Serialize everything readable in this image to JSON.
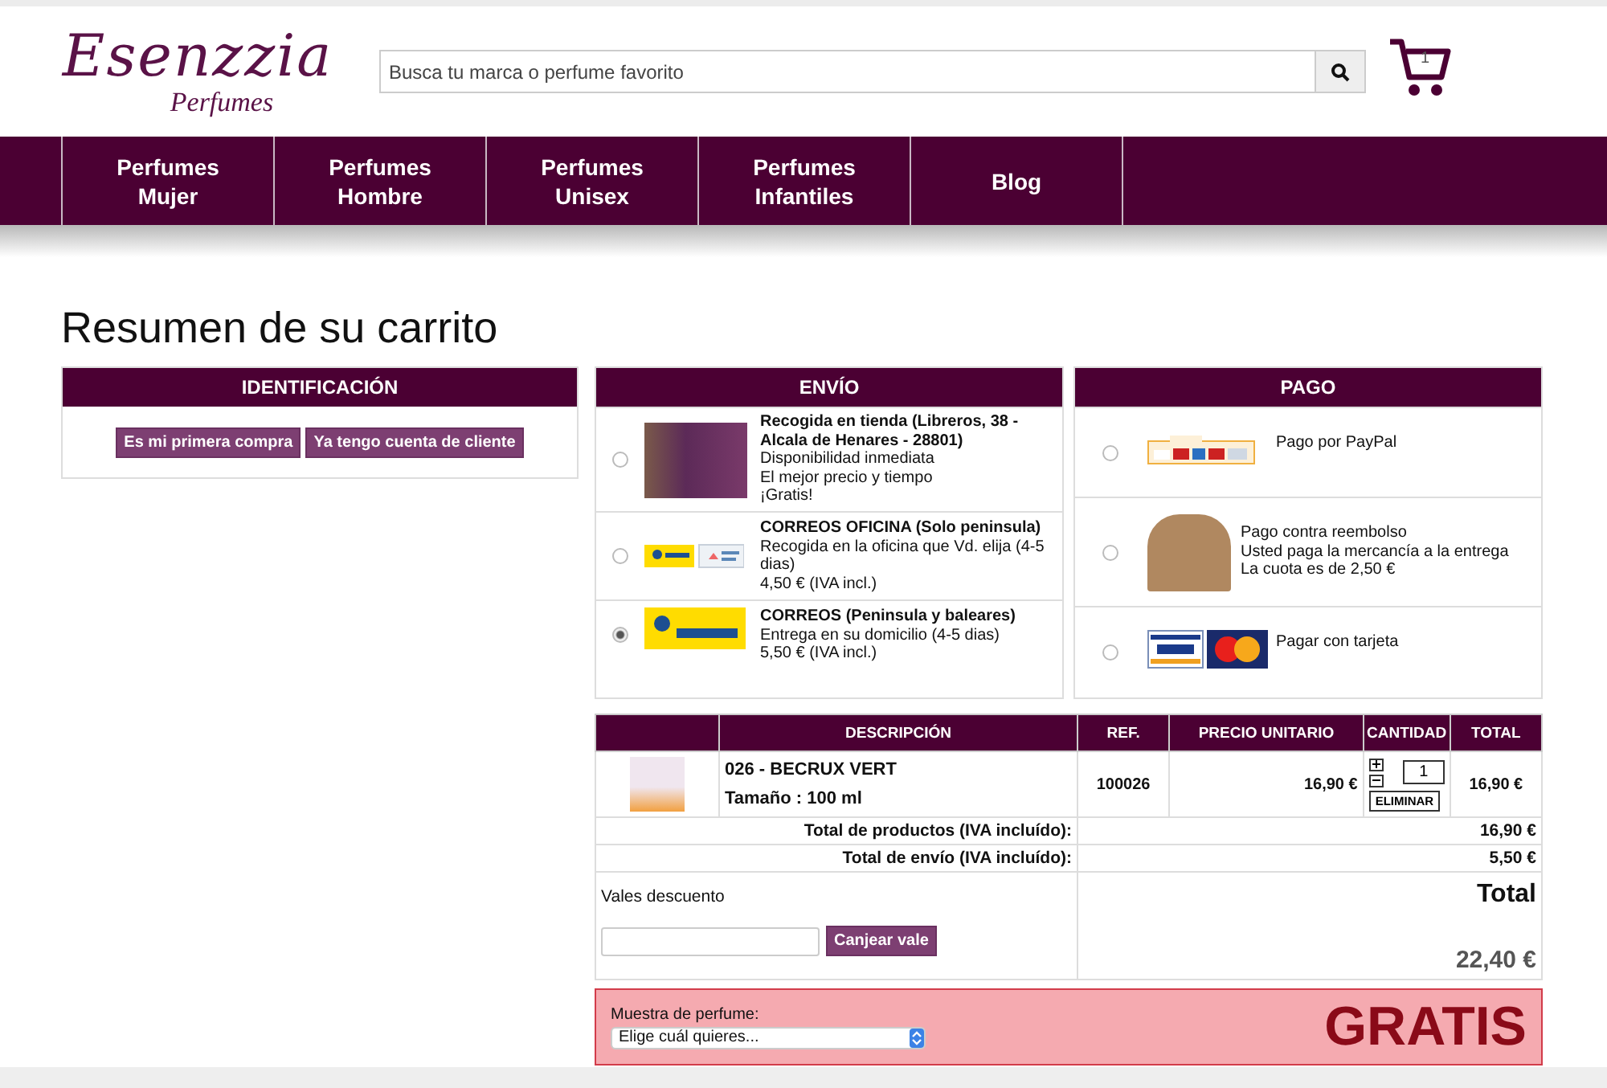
{
  "logo": {
    "name": "Esenzzia",
    "tagline": "Perfumes"
  },
  "search": {
    "placeholder": "Busca tu marca o perfume favorito"
  },
  "cart": {
    "count": "1"
  },
  "nav": [
    {
      "lines": [
        "Perfumes",
        "Mujer"
      ]
    },
    {
      "lines": [
        "Perfumes",
        "Hombre"
      ]
    },
    {
      "lines": [
        "Perfumes",
        "Unisex"
      ]
    },
    {
      "lines": [
        "Perfumes",
        "Infantiles"
      ]
    },
    {
      "lines": [
        "Blog"
      ]
    }
  ],
  "page_title": "Resumen de su carrito",
  "identification": {
    "title": "IDENTIFICACIÓN",
    "buttons": [
      "Es mi primera compra",
      "Ya tengo cuenta de cliente"
    ]
  },
  "shipping": {
    "title": "ENVÍO",
    "options": [
      {
        "kind": "store",
        "title": "Recogida en tienda (Libreros, 38 - Alcala de Henares - 28801)",
        "lines": [
          "Disponibilidad inmediata",
          "El mejor precio y tiempo",
          "¡Gratis!"
        ],
        "selected": false
      },
      {
        "kind": "office",
        "title": "CORREOS OFICINA (Solo peninsula)",
        "lines": [
          "Recogida en la oficina que Vd. elija (4-5 dias)",
          "4,50 € (IVA incl.)"
        ],
        "selected": false
      },
      {
        "kind": "home",
        "title": "CORREOS (Peninsula y baleares)",
        "lines": [
          "Entrega en su domicilio (4-5 dias)",
          "5,50 € (IVA incl.)"
        ],
        "selected": true
      }
    ]
  },
  "payment": {
    "title": "PAGO",
    "options": [
      {
        "kind": "paypal",
        "lines": [
          "Pago por PayPal"
        ],
        "selected": false
      },
      {
        "kind": "cod",
        "lines": [
          "Pago contra reembolso",
          "Usted paga la mercancía a la entrega",
          "La cuota es de 2,50 €"
        ],
        "selected": false
      },
      {
        "kind": "card",
        "lines": [
          "Pagar con tarjeta"
        ],
        "selected": false
      }
    ]
  },
  "cart_table": {
    "columns": [
      "DESCRIPCIÓN",
      "REF.",
      "PRECIO UNITARIO",
      "CANTIDAD",
      "TOTAL"
    ],
    "rows": [
      {
        "name": "026 - BECRUX VERT",
        "size": "Tamaño : 100 ml",
        "ref": "100026",
        "unit_price": "16,90 €",
        "quantity": "1",
        "remove": "ELIMINAR",
        "total": "16,90 €"
      }
    ],
    "totals": [
      {
        "label": "Total de productos (IVA incluído):",
        "value": "16,90 €"
      },
      {
        "label": "Total de envío (IVA incluído):",
        "value": "5,50 €"
      }
    ],
    "voucher": {
      "label": "Vales descuento",
      "button": "Canjear vale"
    },
    "grand_total": {
      "label": "Total",
      "value": "22,40 €"
    }
  },
  "sample": {
    "label": "Muestra de perfume:",
    "select": "Elige cuál quieres...",
    "badge": "GRATIS"
  }
}
